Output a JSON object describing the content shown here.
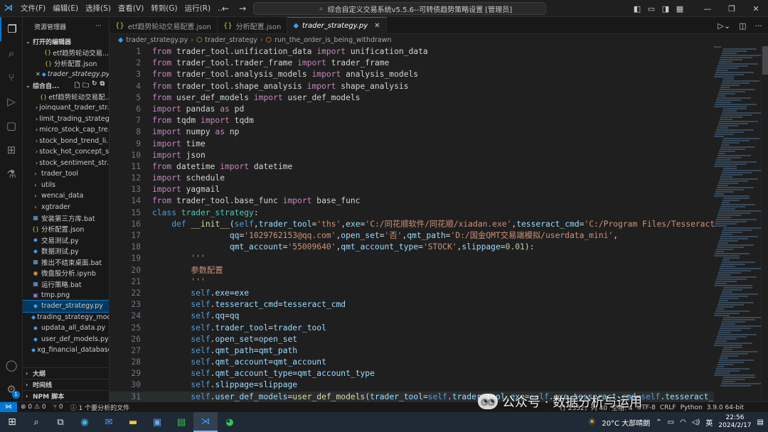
{
  "titlebar": {
    "menu": [
      "文件(F)",
      "编辑(E)",
      "选择(S)",
      "查看(V)",
      "转到(G)",
      "运行(R)",
      "..."
    ],
    "search_text": "综合自定义交易系统v5.5.6--可转债趋势策略设置 [管理员]"
  },
  "sidebar": {
    "title": "资源管理器",
    "open_editors_label": "打开的编辑器",
    "open_editors": [
      {
        "name": "etf趋势轮动交易...",
        "type": "json"
      },
      {
        "name": "分析配置.json",
        "type": "json"
      },
      {
        "name": "trader_strategy.py",
        "type": "py"
      }
    ],
    "workspace_label": "综合自...",
    "files": [
      {
        "name": "etf趋势轮动交易配...",
        "type": "json",
        "indent": 2
      },
      {
        "name": "joinquant_trader_str...",
        "type": "folder",
        "indent": 1
      },
      {
        "name": "limit_trading_strategy",
        "type": "folder",
        "indent": 1
      },
      {
        "name": "micro_stock_cap_tre...",
        "type": "folder",
        "indent": 1
      },
      {
        "name": "stock_bond_trend_li...",
        "type": "folder",
        "indent": 1
      },
      {
        "name": "stock_hot_concept_s...",
        "type": "folder",
        "indent": 1
      },
      {
        "name": "stock_sentiment_str...",
        "type": "folder",
        "indent": 1
      },
      {
        "name": "trader_tool",
        "type": "folder",
        "indent": 0
      },
      {
        "name": "utils",
        "type": "folder",
        "indent": 0
      },
      {
        "name": "wencai_data",
        "type": "folder",
        "indent": 0
      },
      {
        "name": "xgtrader",
        "type": "folder",
        "indent": 0
      },
      {
        "name": "安装第三方库.bat",
        "type": "bat",
        "indent": 0
      },
      {
        "name": "分析配置.json",
        "type": "json",
        "indent": 0
      },
      {
        "name": "交易测试.py",
        "type": "py",
        "indent": 0
      },
      {
        "name": "数据测试.py",
        "type": "py",
        "indent": 0
      },
      {
        "name": "推出不结束桌面.bat",
        "type": "bat",
        "indent": 0
      },
      {
        "name": "微盘股分析.ipynb",
        "type": "nb",
        "indent": 0
      },
      {
        "name": "运行策略.bat",
        "type": "bat",
        "indent": 0
      },
      {
        "name": "tmp.png",
        "type": "img",
        "indent": 0
      },
      {
        "name": "trader_strategy.py",
        "type": "py",
        "indent": 0,
        "selected": true
      },
      {
        "name": "trading_strategy_mod...",
        "type": "py",
        "indent": 0
      },
      {
        "name": "updata_all_data.py",
        "type": "py",
        "indent": 0
      },
      {
        "name": "user_def_models.py",
        "type": "py",
        "indent": 0
      },
      {
        "name": "xg_financial_database...",
        "type": "py",
        "indent": 0
      }
    ],
    "bottom_sections": [
      "大纲",
      "时间线",
      "NPM 脚本"
    ]
  },
  "tabs": [
    {
      "label": "etf趋势轮动交易配置.json",
      "type": "json"
    },
    {
      "label": "分析配置.json",
      "type": "json"
    },
    {
      "label": "trader_strategy.py",
      "type": "py",
      "active": true
    }
  ],
  "breadcrumbs": [
    "trader_strategy.py",
    "trader_strategy",
    "run_the_order_is_being_withdrawn"
  ],
  "code_lines": [
    [
      [
        "kw",
        "from"
      ],
      [
        "mod",
        " trader_tool.unification_data "
      ],
      [
        "kw",
        "import"
      ],
      [
        "mod",
        " unification_data"
      ]
    ],
    [
      [
        "kw",
        "from"
      ],
      [
        "mod",
        " trader_tool.trader_frame "
      ],
      [
        "kw",
        "import"
      ],
      [
        "mod",
        " trader_frame"
      ]
    ],
    [
      [
        "kw",
        "from"
      ],
      [
        "mod",
        " trader_tool.analysis_models "
      ],
      [
        "kw",
        "import"
      ],
      [
        "mod",
        " analysis_models"
      ]
    ],
    [
      [
        "kw",
        "from"
      ],
      [
        "mod",
        " trader_tool.shape_analysis "
      ],
      [
        "kw",
        "import"
      ],
      [
        "mod",
        " shape_analysis"
      ]
    ],
    [
      [
        "kw",
        "from"
      ],
      [
        "mod",
        " user_def_models "
      ],
      [
        "kw",
        "import"
      ],
      [
        "mod",
        " user_def_models"
      ]
    ],
    [
      [
        "kw",
        "import"
      ],
      [
        "mod",
        " pandas "
      ],
      [
        "kw",
        "as"
      ],
      [
        "mod",
        " pd"
      ]
    ],
    [
      [
        "kw",
        "from"
      ],
      [
        "mod",
        " tqdm "
      ],
      [
        "kw",
        "import"
      ],
      [
        "mod",
        " tqdm"
      ]
    ],
    [
      [
        "kw",
        "import"
      ],
      [
        "mod",
        " numpy "
      ],
      [
        "kw",
        "as"
      ],
      [
        "mod",
        " np"
      ]
    ],
    [
      [
        "kw",
        "import"
      ],
      [
        "mod",
        " time"
      ]
    ],
    [
      [
        "kw",
        "import"
      ],
      [
        "mod",
        " json"
      ]
    ],
    [
      [
        "kw",
        "from"
      ],
      [
        "mod",
        " datetime "
      ],
      [
        "kw",
        "import"
      ],
      [
        "mod",
        " datetime"
      ]
    ],
    [
      [
        "kw",
        "import"
      ],
      [
        "mod",
        " schedule"
      ]
    ],
    [
      [
        "kw",
        "import"
      ],
      [
        "mod",
        " yagmail"
      ]
    ],
    [
      [
        "kw",
        "from"
      ],
      [
        "mod",
        " trader_tool.base_func "
      ],
      [
        "kw",
        "import"
      ],
      [
        "mod",
        " base_func"
      ]
    ],
    [
      [
        "kw2",
        "class"
      ],
      [
        "mod",
        " "
      ],
      [
        "cls",
        "trader_strategy"
      ],
      [
        "mod",
        ":"
      ]
    ],
    [
      [
        "mod",
        "    "
      ],
      [
        "kw2",
        "def"
      ],
      [
        "mod",
        " "
      ],
      [
        "fn",
        "__init__"
      ],
      [
        "mod",
        "("
      ],
      [
        "self",
        "self"
      ],
      [
        "mod",
        ","
      ],
      [
        "var",
        "trader_tool"
      ],
      [
        "mod",
        "="
      ],
      [
        "str",
        "'ths'"
      ],
      [
        "mod",
        ","
      ],
      [
        "var",
        "exe"
      ],
      [
        "mod",
        "="
      ],
      [
        "str",
        "'C:/同花顺软件/同花顺/xiadan.exe'"
      ],
      [
        "mod",
        ","
      ],
      [
        "var",
        "tesseract_cmd"
      ],
      [
        "mod",
        "="
      ],
      [
        "str",
        "'C:/Program Files/Tesseract-OC"
      ]
    ],
    [
      [
        "mod",
        "                "
      ],
      [
        "var",
        "qq"
      ],
      [
        "mod",
        "="
      ],
      [
        "str",
        "'1029762153@qq.com'"
      ],
      [
        "mod",
        ","
      ],
      [
        "var",
        "open_set"
      ],
      [
        "mod",
        "="
      ],
      [
        "str",
        "'否'"
      ],
      [
        "mod",
        ","
      ],
      [
        "var",
        "qmt_path"
      ],
      [
        "mod",
        "="
      ],
      [
        "str",
        "'D:/国金QMT交易端模拟/userdata_mini'"
      ],
      [
        "mod",
        ","
      ]
    ],
    [
      [
        "mod",
        "                "
      ],
      [
        "var",
        "qmt_account"
      ],
      [
        "mod",
        "="
      ],
      [
        "str",
        "'55009640'"
      ],
      [
        "mod",
        ","
      ],
      [
        "var",
        "qmt_account_type"
      ],
      [
        "mod",
        "="
      ],
      [
        "str",
        "'STOCK'"
      ],
      [
        "mod",
        ","
      ],
      [
        "var",
        "slippage"
      ],
      [
        "mod",
        "="
      ],
      [
        "num",
        "0.01"
      ],
      [
        "mod",
        "):"
      ]
    ],
    [
      [
        "mod",
        "        "
      ],
      [
        "cmt",
        "'''"
      ]
    ],
    [
      [
        "mod",
        "        "
      ],
      [
        "cmt",
        "参数配置"
      ]
    ],
    [
      [
        "mod",
        "        "
      ],
      [
        "cmt",
        "'''"
      ]
    ],
    [
      [
        "mod",
        "        "
      ],
      [
        "self",
        "self"
      ],
      [
        "mod",
        "."
      ],
      [
        "var",
        "exe"
      ],
      [
        "mod",
        "="
      ],
      [
        "var",
        "exe"
      ]
    ],
    [
      [
        "mod",
        "        "
      ],
      [
        "self",
        "self"
      ],
      [
        "mod",
        "."
      ],
      [
        "var",
        "tesseract_cmd"
      ],
      [
        "mod",
        "="
      ],
      [
        "var",
        "tesseract_cmd"
      ]
    ],
    [
      [
        "mod",
        "        "
      ],
      [
        "self",
        "self"
      ],
      [
        "mod",
        "."
      ],
      [
        "var",
        "qq"
      ],
      [
        "mod",
        "="
      ],
      [
        "var",
        "qq"
      ]
    ],
    [
      [
        "mod",
        "        "
      ],
      [
        "self",
        "self"
      ],
      [
        "mod",
        "."
      ],
      [
        "var",
        "trader_tool"
      ],
      [
        "mod",
        "="
      ],
      [
        "var",
        "trader_tool"
      ]
    ],
    [
      [
        "mod",
        "        "
      ],
      [
        "self",
        "self"
      ],
      [
        "mod",
        "."
      ],
      [
        "var",
        "open_set"
      ],
      [
        "mod",
        "="
      ],
      [
        "var",
        "open_set"
      ]
    ],
    [
      [
        "mod",
        "        "
      ],
      [
        "self",
        "self"
      ],
      [
        "mod",
        "."
      ],
      [
        "var",
        "qmt_path"
      ],
      [
        "mod",
        "="
      ],
      [
        "var",
        "qmt_path"
      ]
    ],
    [
      [
        "mod",
        "        "
      ],
      [
        "self",
        "self"
      ],
      [
        "mod",
        "."
      ],
      [
        "var",
        "qmt_account"
      ],
      [
        "mod",
        "="
      ],
      [
        "var",
        "qmt_account"
      ]
    ],
    [
      [
        "mod",
        "        "
      ],
      [
        "self",
        "self"
      ],
      [
        "mod",
        "."
      ],
      [
        "var",
        "qmt_account_type"
      ],
      [
        "mod",
        "="
      ],
      [
        "var",
        "qmt_account_type"
      ]
    ],
    [
      [
        "mod",
        "        "
      ],
      [
        "self",
        "self"
      ],
      [
        "mod",
        "."
      ],
      [
        "var",
        "slippage"
      ],
      [
        "mod",
        "="
      ],
      [
        "var",
        "slippage"
      ]
    ],
    [
      [
        "mod",
        "        "
      ],
      [
        "self",
        "self"
      ],
      [
        "mod",
        "."
      ],
      [
        "var",
        "user_def_models"
      ],
      [
        "mod",
        "="
      ],
      [
        "fn",
        "user_def_models"
      ],
      [
        "mod",
        "("
      ],
      [
        "var",
        "trader_tool"
      ],
      [
        "mod",
        "="
      ],
      [
        "self",
        "self"
      ],
      [
        "mod",
        "."
      ],
      [
        "var",
        "trader_tool"
      ],
      [
        "mod",
        ","
      ],
      [
        "var",
        "exe"
      ],
      [
        "mod",
        "="
      ],
      [
        "self",
        "self"
      ],
      [
        "mod",
        "."
      ],
      [
        "var",
        "exe"
      ],
      [
        "mod",
        ","
      ],
      [
        "var",
        "tesseract_cmd"
      ],
      [
        "mod",
        "="
      ],
      [
        "self",
        "self"
      ],
      [
        "mod",
        "."
      ],
      [
        "var",
        "tesseract_cmd"
      ]
    ]
  ],
  "current_line": 31,
  "statusbar": {
    "errors": "⊗ 0 ⚠ 0",
    "ports": "⑂ 0",
    "analysis": "ⓘ 1 个要分析的文件",
    "position": "行 2352，列 40",
    "spaces": "空格: 4",
    "encoding": "UTF-8",
    "eol": "CRLF",
    "language": "Python",
    "version": "3.9.0 64-bit"
  },
  "watermark": "公众号 · 数据分析与运用",
  "taskbar": {
    "weather": "20°C 大部晴朗",
    "ime": "英",
    "time": "22:56",
    "date": "2024/2/17"
  }
}
